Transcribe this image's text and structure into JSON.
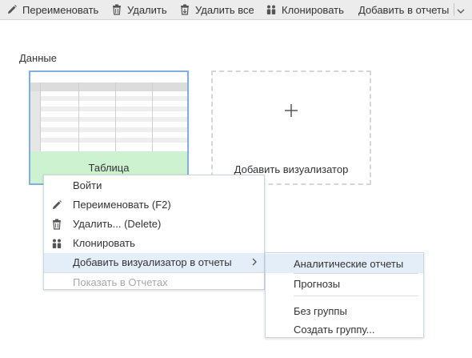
{
  "toolbar": {
    "rename_label": "Переименовать",
    "delete_label": "Удалить",
    "delete_all_label": "Удалить все",
    "clone_label": "Клонировать",
    "add_to_reports_label": "Добавить в отчеты"
  },
  "section": {
    "title": "Данные"
  },
  "card": {
    "label": "Таблица"
  },
  "add_card": {
    "label": "Добавить визуализатор"
  },
  "context_menu": {
    "items": [
      {
        "label": "Войти"
      },
      {
        "label": "Переименовать (F2)",
        "icon": "pencil-icon"
      },
      {
        "label": "Удалить... (Delete)",
        "icon": "trash-icon"
      },
      {
        "label": "Клонировать",
        "icon": "clone-icon"
      },
      {
        "label": "Добавить визуализатор в отчеты"
      },
      {
        "label": "Показать в Отчетах"
      }
    ]
  },
  "submenu": {
    "items": [
      {
        "label": "Аналитические отчеты"
      },
      {
        "label": "Прогнозы"
      },
      {
        "label": "Без группы"
      },
      {
        "label": "Создать группу..."
      }
    ]
  },
  "colors": {
    "card_border": "#7fb0e0",
    "card_footer": "#ccf2cf",
    "highlight": "#e3eef9"
  }
}
